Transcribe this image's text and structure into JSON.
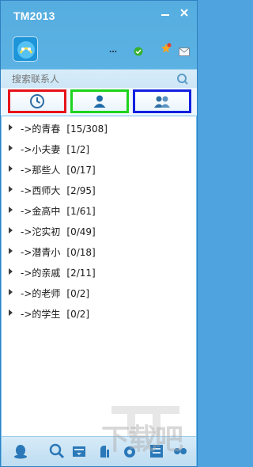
{
  "window": {
    "title": "TM2013"
  },
  "profile": {
    "nickname": "..."
  },
  "search": {
    "placeholder": "搜索联系人"
  },
  "tabs": [
    {
      "name": "recent",
      "icon": "clock-icon",
      "border_color": "#e6141a"
    },
    {
      "name": "contacts",
      "icon": "person-icon",
      "border_color": "#1dd41d"
    },
    {
      "name": "groups",
      "icon": "people-icon",
      "border_color": "#1220e0"
    }
  ],
  "groups": [
    {
      "name": "->的青春",
      "count": "[15/308]"
    },
    {
      "name": "->小夫妻",
      "count": "[1/2]"
    },
    {
      "name": "->那些人",
      "count": "[0/17]"
    },
    {
      "name": "->西师大",
      "count": "[2/95]"
    },
    {
      "name": "->金高中",
      "count": "[1/61]"
    },
    {
      "name": "->沱实初",
      "count": "[0/49]"
    },
    {
      "name": "->潜青小",
      "count": "[0/18]"
    },
    {
      "name": "->的亲戚",
      "count": "[2/11]"
    },
    {
      "name": "->的老师",
      "count": "[0/2]"
    },
    {
      "name": "->的学生",
      "count": "[0/2]"
    }
  ],
  "bottombar": {
    "icons": [
      "qq-menu-icon",
      "search-icon",
      "file-box-icon",
      "tool-icon",
      "app-icon",
      "message-manager-icon",
      "app-box-icon"
    ]
  },
  "watermark": {
    "text": "下载吧"
  }
}
